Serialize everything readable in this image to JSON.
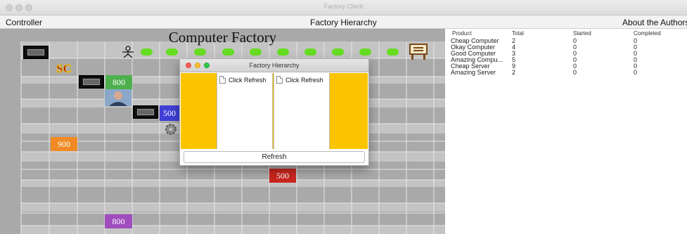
{
  "window": {
    "title": "Factory Client"
  },
  "menu": {
    "left": "Controller",
    "center": "Factory Hierarchy",
    "right": "About the Authors"
  },
  "factory": {
    "title": "Computer Factory",
    "icons": {
      "logo": "sc-logo-icon",
      "worker": "worker-icon",
      "portrait": "employee-portrait-icon",
      "gear": "gear-icon",
      "conveyor": "conveyor-pills",
      "workstation": "workstation-icon"
    },
    "colors": {
      "green": "#4db04d",
      "blue": "#3f3fd6",
      "orange": "#f08a24",
      "red": "#c8261e",
      "purple": "#a04dbf",
      "pill": "#66dd22"
    },
    "blocks": [
      {
        "label": "800",
        "color": "green"
      },
      {
        "label": "500",
        "color": "blue"
      },
      {
        "label": "900",
        "color": "orange"
      },
      {
        "label": "500",
        "color": "red"
      },
      {
        "label": "800",
        "color": "purple"
      }
    ]
  },
  "table": {
    "headers": [
      "Product",
      "Total",
      "Started",
      "Completed"
    ],
    "rows": [
      [
        "Cheap Computer",
        "2",
        "0",
        "0"
      ],
      [
        "Okay Computer",
        "4",
        "0",
        "0"
      ],
      [
        "Good Computer",
        "3",
        "0",
        "0"
      ],
      [
        "Amazing Compu...",
        "5",
        "0",
        "0"
      ],
      [
        "Cheap Server",
        "9",
        "0",
        "0"
      ],
      [
        "Amazing Server",
        "2",
        "0",
        "0"
      ]
    ]
  },
  "dialog": {
    "title": "Factory Hierarchy",
    "tree_left": "Click Refresh",
    "tree_right": "Click Refresh",
    "refresh": "Refresh"
  }
}
